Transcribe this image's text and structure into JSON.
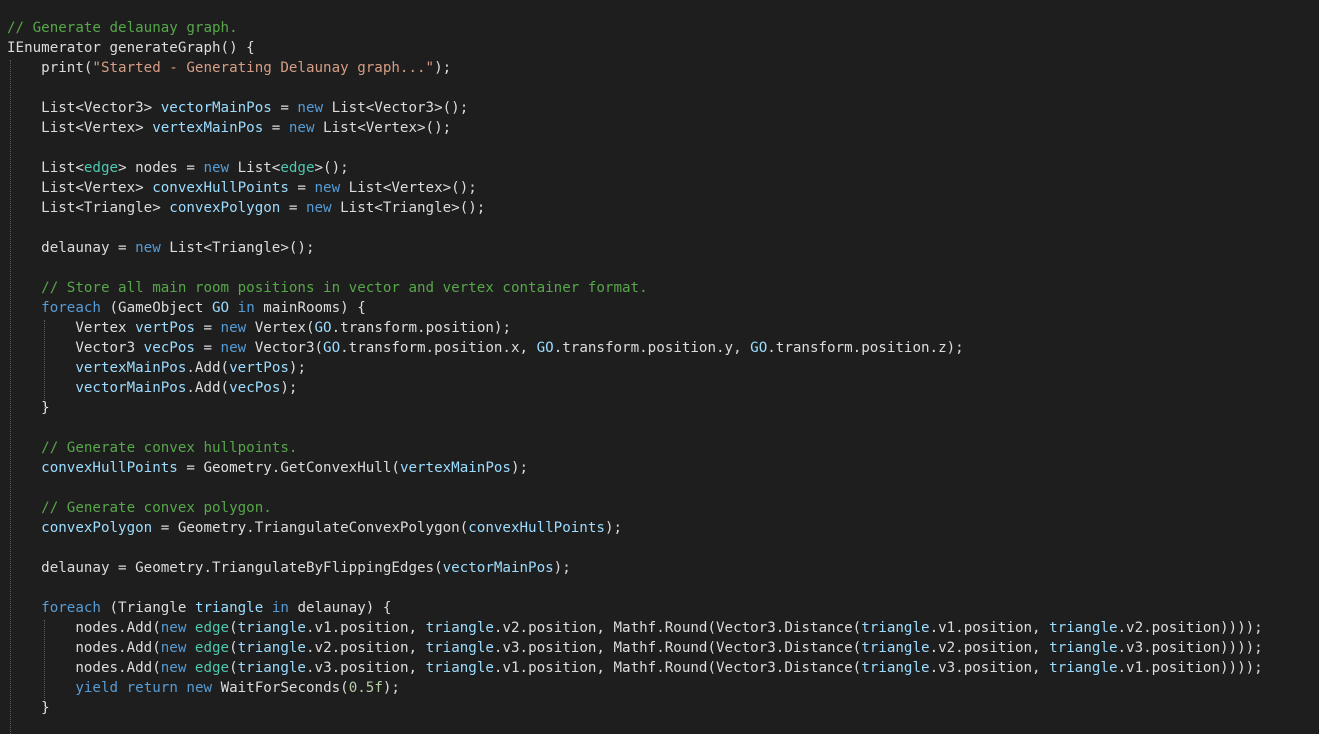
{
  "colors": {
    "background": "#1e1e1e",
    "default": "#dcdcdc",
    "comment": "#57a64a",
    "keyword": "#569cd6",
    "type": "#4ec9b0",
    "string": "#d69d85",
    "number": "#b5cea8",
    "variable": "#9cdcfe",
    "method": "#dcdcaa",
    "guide": "#5a5a5a"
  },
  "code_lines": [
    [
      [
        "// Generate delaunay graph.",
        "comment"
      ]
    ],
    [
      [
        "IEnumerator generateGraph() {",
        "default"
      ]
    ],
    [
      [
        "    print(",
        "default"
      ],
      [
        "\"Started - Generating Delaunay graph...\"",
        "string"
      ],
      [
        ");",
        "default"
      ]
    ],
    [],
    [
      [
        "    List<Vector3> ",
        "default"
      ],
      [
        "vectorMainPos",
        "variable"
      ],
      [
        " = ",
        "default"
      ],
      [
        "new",
        "keyword"
      ],
      [
        " List<Vector3>();",
        "default"
      ]
    ],
    [
      [
        "    List<Vertex> ",
        "default"
      ],
      [
        "vertexMainPos",
        "variable"
      ],
      [
        " = ",
        "default"
      ],
      [
        "new",
        "keyword"
      ],
      [
        " List<Vertex>();",
        "default"
      ]
    ],
    [],
    [
      [
        "    List<",
        "default"
      ],
      [
        "edge",
        "type"
      ],
      [
        "> nodes = ",
        "default"
      ],
      [
        "new",
        "keyword"
      ],
      [
        " List<",
        "default"
      ],
      [
        "edge",
        "type"
      ],
      [
        ">();",
        "default"
      ]
    ],
    [
      [
        "    List<Vertex> ",
        "default"
      ],
      [
        "convexHullPoints",
        "variable"
      ],
      [
        " = ",
        "default"
      ],
      [
        "new",
        "keyword"
      ],
      [
        " List<Vertex>();",
        "default"
      ]
    ],
    [
      [
        "    List<Triangle> ",
        "default"
      ],
      [
        "convexPolygon",
        "variable"
      ],
      [
        " = ",
        "default"
      ],
      [
        "new",
        "keyword"
      ],
      [
        " List<Triangle>();",
        "default"
      ]
    ],
    [],
    [
      [
        "    delaunay = ",
        "default"
      ],
      [
        "new",
        "keyword"
      ],
      [
        " List<Triangle>();",
        "default"
      ]
    ],
    [],
    [
      [
        "    // Store all main room positions in vector and vertex container format.",
        "comment"
      ]
    ],
    [
      [
        "    ",
        "default"
      ],
      [
        "foreach",
        "keyword"
      ],
      [
        " (GameObject ",
        "default"
      ],
      [
        "GO",
        "variable"
      ],
      [
        " ",
        "default"
      ],
      [
        "in",
        "keyword"
      ],
      [
        " mainRooms) {",
        "default"
      ]
    ],
    [
      [
        "        Vertex ",
        "default"
      ],
      [
        "vertPos",
        "variable"
      ],
      [
        " = ",
        "default"
      ],
      [
        "new",
        "keyword"
      ],
      [
        " Vertex(",
        "default"
      ],
      [
        "GO",
        "variable"
      ],
      [
        ".transform.position);",
        "default"
      ]
    ],
    [
      [
        "        Vector3 ",
        "default"
      ],
      [
        "vecPos",
        "variable"
      ],
      [
        " = ",
        "default"
      ],
      [
        "new",
        "keyword"
      ],
      [
        " Vector3(",
        "default"
      ],
      [
        "GO",
        "variable"
      ],
      [
        ".transform.position.x, ",
        "default"
      ],
      [
        "GO",
        "variable"
      ],
      [
        ".transform.position.y, ",
        "default"
      ],
      [
        "GO",
        "variable"
      ],
      [
        ".transform.position.z);",
        "default"
      ]
    ],
    [
      [
        "        ",
        "default"
      ],
      [
        "vertexMainPos",
        "variable"
      ],
      [
        ".Add(",
        "default"
      ],
      [
        "vertPos",
        "variable"
      ],
      [
        ");",
        "default"
      ]
    ],
    [
      [
        "        ",
        "default"
      ],
      [
        "vectorMainPos",
        "variable"
      ],
      [
        ".Add(",
        "default"
      ],
      [
        "vecPos",
        "variable"
      ],
      [
        ");",
        "default"
      ]
    ],
    [
      [
        "    }",
        "default"
      ]
    ],
    [],
    [
      [
        "    // Generate convex hullpoints.",
        "comment"
      ]
    ],
    [
      [
        "    ",
        "default"
      ],
      [
        "convexHullPoints",
        "variable"
      ],
      [
        " = Geometry.GetConvexHull(",
        "default"
      ],
      [
        "vertexMainPos",
        "variable"
      ],
      [
        ");",
        "default"
      ]
    ],
    [],
    [
      [
        "    // Generate convex polygon.",
        "comment"
      ]
    ],
    [
      [
        "    ",
        "default"
      ],
      [
        "convexPolygon",
        "variable"
      ],
      [
        " = Geometry.TriangulateConvexPolygon(",
        "default"
      ],
      [
        "convexHullPoints",
        "variable"
      ],
      [
        ");",
        "default"
      ]
    ],
    [],
    [
      [
        "    delaunay = Geometry.TriangulateByFlippingEdges(",
        "default"
      ],
      [
        "vectorMainPos",
        "variable"
      ],
      [
        ");",
        "default"
      ]
    ],
    [],
    [
      [
        "    ",
        "default"
      ],
      [
        "foreach",
        "keyword"
      ],
      [
        " (Triangle ",
        "default"
      ],
      [
        "triangle",
        "variable"
      ],
      [
        " ",
        "default"
      ],
      [
        "in",
        "keyword"
      ],
      [
        " delaunay) {",
        "default"
      ]
    ],
    [
      [
        "        nodes.Add(",
        "default"
      ],
      [
        "new",
        "keyword"
      ],
      [
        " ",
        "default"
      ],
      [
        "edge",
        "type"
      ],
      [
        "(",
        "default"
      ],
      [
        "triangle",
        "variable"
      ],
      [
        ".v1.position, ",
        "default"
      ],
      [
        "triangle",
        "variable"
      ],
      [
        ".v2.position, Mathf.Round(Vector3.Distance(",
        "default"
      ],
      [
        "triangle",
        "variable"
      ],
      [
        ".v1.position, ",
        "default"
      ],
      [
        "triangle",
        "variable"
      ],
      [
        ".v2.position))));",
        "default"
      ]
    ],
    [
      [
        "        nodes.Add(",
        "default"
      ],
      [
        "new",
        "keyword"
      ],
      [
        " ",
        "default"
      ],
      [
        "edge",
        "type"
      ],
      [
        "(",
        "default"
      ],
      [
        "triangle",
        "variable"
      ],
      [
        ".v2.position, ",
        "default"
      ],
      [
        "triangle",
        "variable"
      ],
      [
        ".v3.position, Mathf.Round(Vector3.Distance(",
        "default"
      ],
      [
        "triangle",
        "variable"
      ],
      [
        ".v2.position, ",
        "default"
      ],
      [
        "triangle",
        "variable"
      ],
      [
        ".v3.position))));",
        "default"
      ]
    ],
    [
      [
        "        nodes.Add(",
        "default"
      ],
      [
        "new",
        "keyword"
      ],
      [
        " ",
        "default"
      ],
      [
        "edge",
        "type"
      ],
      [
        "(",
        "default"
      ],
      [
        "triangle",
        "variable"
      ],
      [
        ".v3.position, ",
        "default"
      ],
      [
        "triangle",
        "variable"
      ],
      [
        ".v1.position, Mathf.Round(Vector3.Distance(",
        "default"
      ],
      [
        "triangle",
        "variable"
      ],
      [
        ".v3.position, ",
        "default"
      ],
      [
        "triangle",
        "variable"
      ],
      [
        ".v1.position))));",
        "default"
      ]
    ],
    [
      [
        "        ",
        "default"
      ],
      [
        "yield",
        "keyword"
      ],
      [
        " ",
        "default"
      ],
      [
        "return",
        "keyword"
      ],
      [
        " ",
        "default"
      ],
      [
        "new",
        "keyword"
      ],
      [
        " WaitForSeconds(",
        "default"
      ],
      [
        "0.5f",
        "number"
      ],
      [
        ");",
        "default"
      ]
    ],
    [
      [
        "    }",
        "default"
      ]
    ]
  ]
}
